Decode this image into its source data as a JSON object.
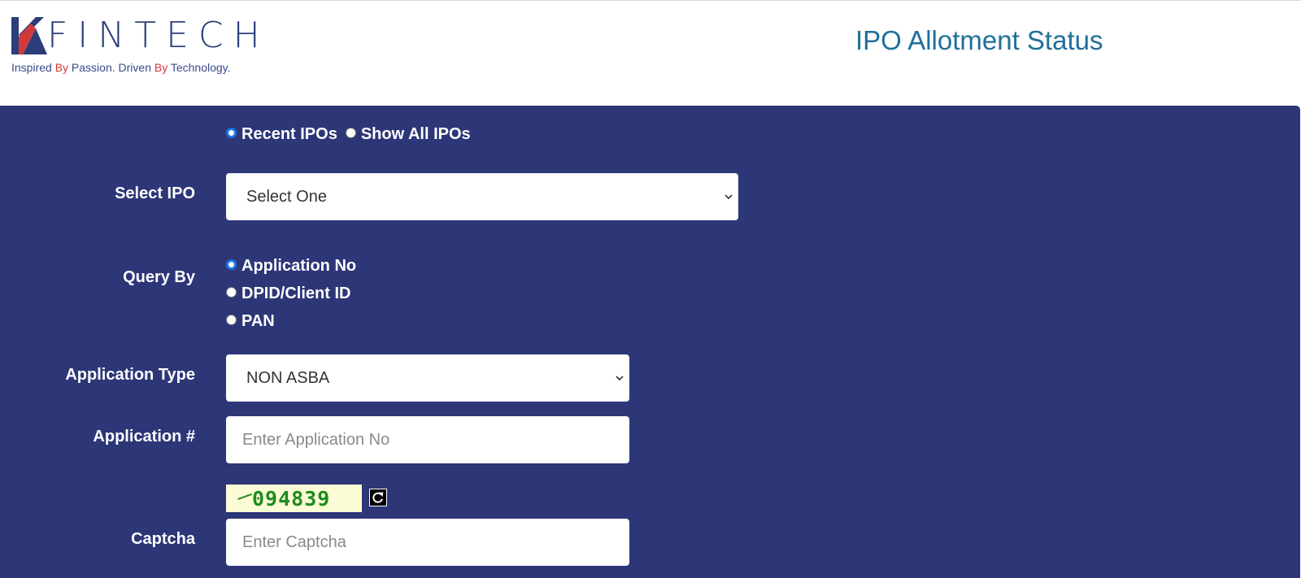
{
  "header": {
    "logo_text": "FINTECH",
    "tagline": {
      "part1": "Inspired ",
      "by1": "By",
      "part2": " Passion. Driven ",
      "by2": "By",
      "part3": " Technology."
    },
    "title": "IPO Allotment Status"
  },
  "ipo_filter": {
    "options": [
      "Recent IPOs",
      "Show All IPOs"
    ],
    "selected": "Recent IPOs"
  },
  "select_ipo": {
    "label": "Select IPO",
    "value": "Select One"
  },
  "query_by": {
    "label": "Query By",
    "options": [
      "Application No",
      "DPID/Client ID",
      "PAN"
    ],
    "selected": "Application No"
  },
  "application_type": {
    "label": "Application Type",
    "value": "NON ASBA"
  },
  "application_no": {
    "label": "Application #",
    "placeholder": "Enter Application No",
    "value": ""
  },
  "captcha": {
    "code": "094839",
    "label": "Captcha",
    "placeholder": "Enter Captcha",
    "value": ""
  },
  "icons": {
    "refresh": "refresh-icon",
    "dropdown": "chevron-down-icon",
    "logo": "kfintech-logo-icon"
  },
  "colors": {
    "panel_bg": "#2d3677",
    "title": "#1f6f9a",
    "brand_navy": "#2c3e7a",
    "brand_red": "#d23a3a",
    "captcha_text": "#1e8c1e",
    "captcha_bg": "#fbfbd6"
  }
}
